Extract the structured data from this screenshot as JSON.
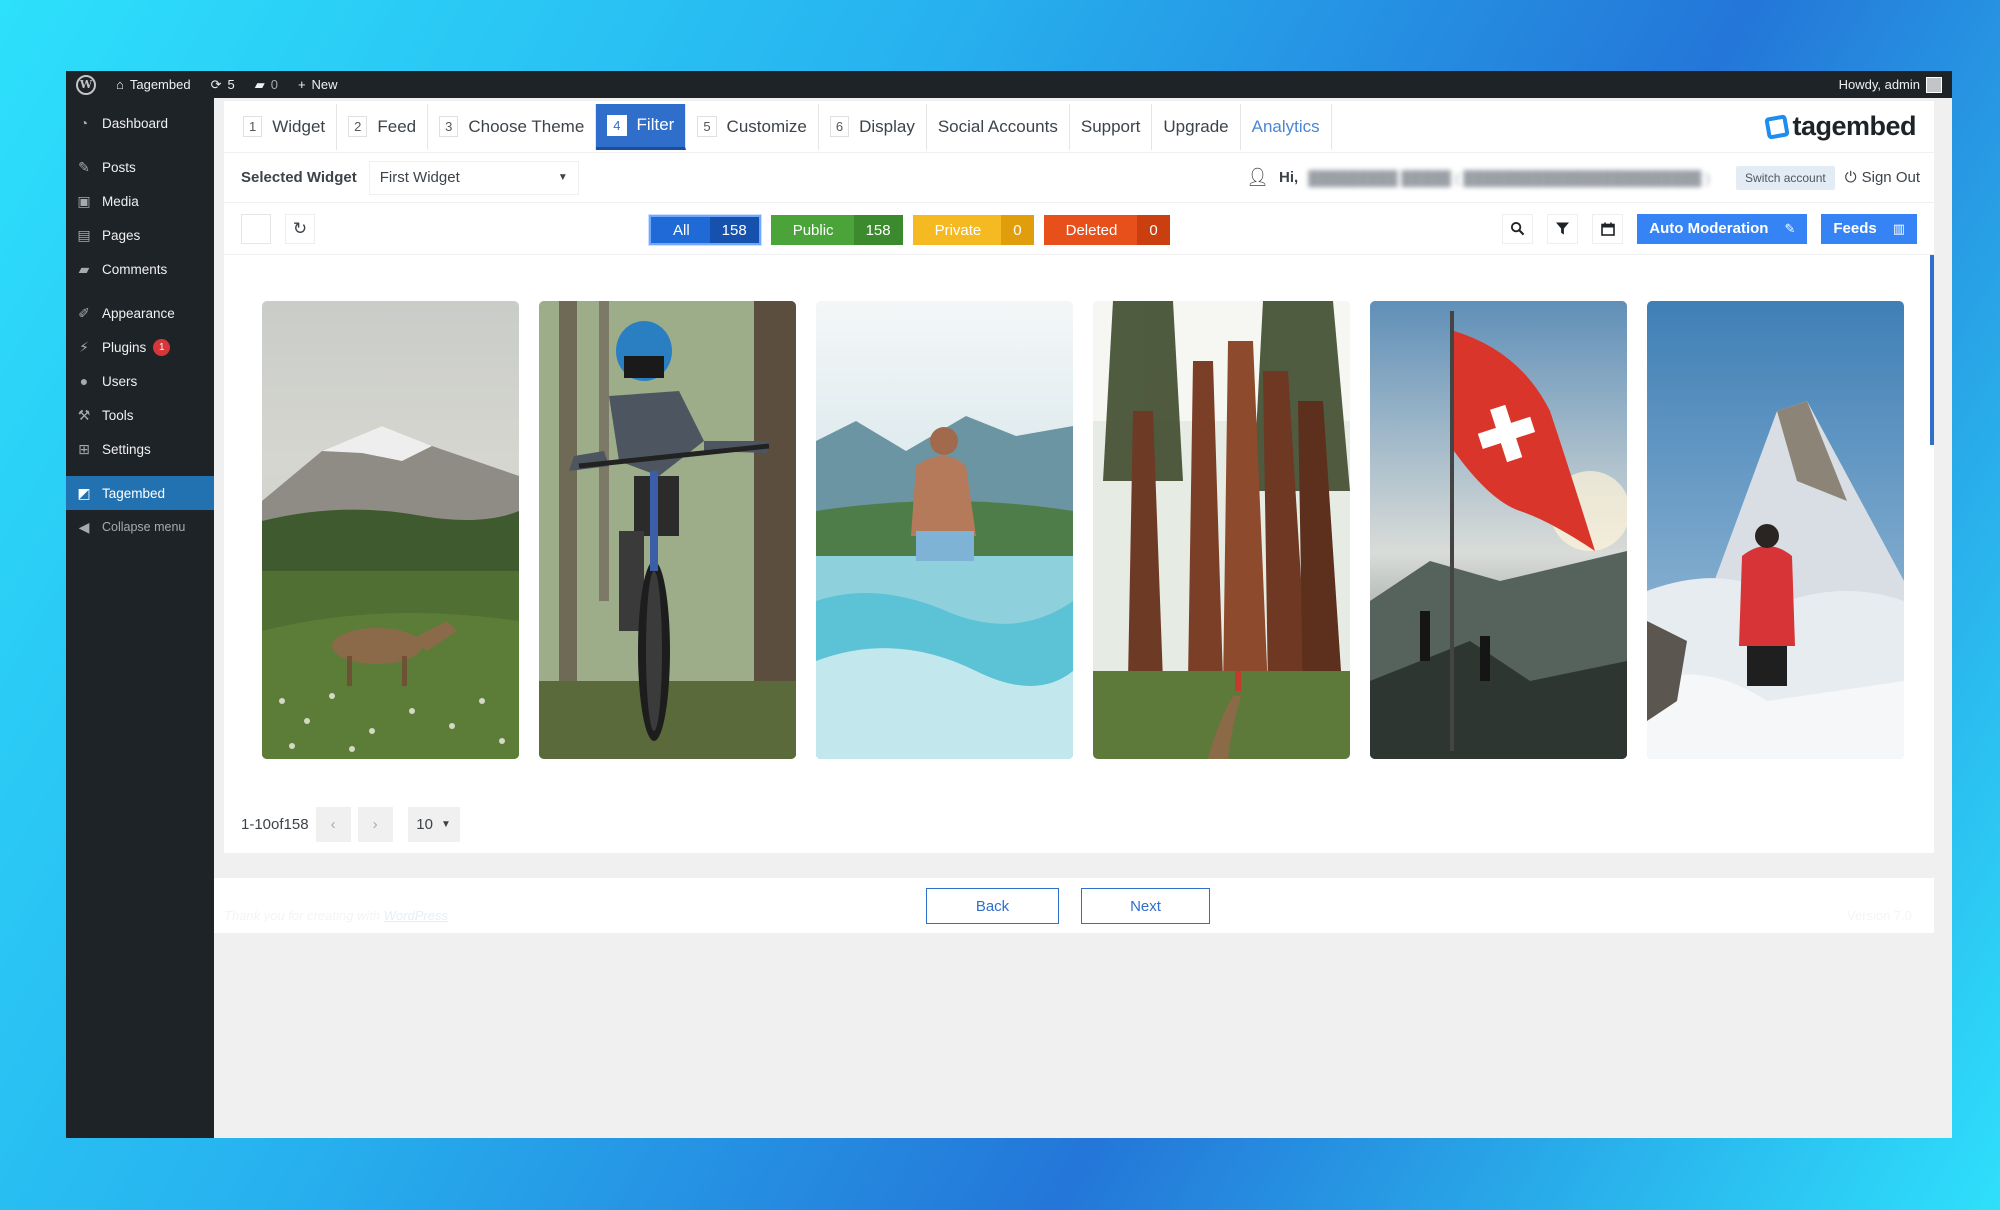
{
  "adminbar": {
    "site_name": "Tagembed",
    "updates_count": "5",
    "comments_count": "0",
    "new_label": "New",
    "howdy": "Howdy, admin"
  },
  "sidebar": {
    "items": [
      {
        "label": "Dashboard",
        "icon": "dashboard-icon"
      },
      {
        "label": "Posts",
        "icon": "pin-icon"
      },
      {
        "label": "Media",
        "icon": "media-icon"
      },
      {
        "label": "Pages",
        "icon": "pages-icon"
      },
      {
        "label": "Comments",
        "icon": "comment-icon"
      },
      {
        "label": "Appearance",
        "icon": "brush-icon"
      },
      {
        "label": "Plugins",
        "icon": "plugin-icon",
        "badge": "1"
      },
      {
        "label": "Users",
        "icon": "user-icon"
      },
      {
        "label": "Tools",
        "icon": "wrench-icon"
      },
      {
        "label": "Settings",
        "icon": "settings-icon"
      },
      {
        "label": "Tagembed",
        "icon": "tagembed-icon"
      },
      {
        "label": "Collapse menu",
        "icon": "collapse-icon"
      }
    ]
  },
  "tabs": [
    {
      "num": "1",
      "label": "Widget"
    },
    {
      "num": "2",
      "label": "Feed"
    },
    {
      "num": "3",
      "label": "Choose Theme"
    },
    {
      "num": "4",
      "label": "Filter"
    },
    {
      "num": "5",
      "label": "Customize"
    },
    {
      "num": "6",
      "label": "Display"
    },
    {
      "label": "Social Accounts"
    },
    {
      "label": "Support"
    },
    {
      "label": "Upgrade"
    },
    {
      "label": "Analytics"
    }
  ],
  "brand": "tagembed",
  "selected_widget": {
    "label": "Selected Widget",
    "value": "First Widget"
  },
  "user": {
    "hi": "Hi,",
    "switch_account": "Switch account",
    "sign_out": "Sign Out"
  },
  "filters": [
    {
      "label": "All",
      "count": "158",
      "color": "#1f6ad6",
      "count_color": "#1652ad"
    },
    {
      "label": "Public",
      "count": "158",
      "color": "#4aa43a",
      "count_color": "#3b8a2d"
    },
    {
      "label": "Private",
      "count": "0",
      "color": "#f5b921",
      "count_color": "#e09e0c"
    },
    {
      "label": "Deleted",
      "count": "0",
      "color": "#e8501b",
      "count_color": "#c93f10"
    }
  ],
  "toolbar": {
    "auto_moderation": "Auto Moderation",
    "feeds": "Feeds"
  },
  "pager": {
    "range": "1-10of158",
    "per_page": "10"
  },
  "nav": {
    "back": "Back",
    "next": "Next"
  },
  "footer": {
    "thanks": "Thank you for creating with",
    "wp_link": "WordPress",
    "version": "Version 7.0"
  },
  "gallery": [
    {
      "name": "gallery-tile-deer-mountain"
    },
    {
      "name": "gallery-tile-mountain-biker"
    },
    {
      "name": "gallery-tile-lake-man"
    },
    {
      "name": "gallery-tile-redwood-forest"
    },
    {
      "name": "gallery-tile-swiss-flag"
    },
    {
      "name": "gallery-tile-matterhorn-hiker"
    }
  ]
}
